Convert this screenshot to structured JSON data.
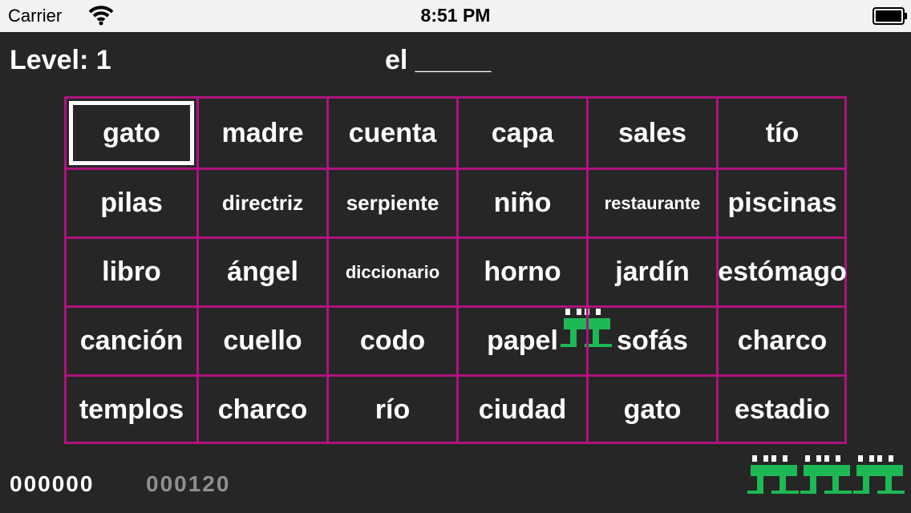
{
  "status": {
    "carrier": "Carrier",
    "time": "8:51 PM"
  },
  "hud": {
    "level": "Level: 1",
    "prompt": "el _____"
  },
  "grid": {
    "rows": [
      [
        "gato",
        "madre",
        "cuenta",
        "capa",
        "sales",
        "tío"
      ],
      [
        "pilas",
        "directriz",
        "serpiente",
        "niño",
        "restaurante",
        "piscinas"
      ],
      [
        "libro",
        "ángel",
        "diccionario",
        "horno",
        "jardín",
        "estómago"
      ],
      [
        "canción",
        "cuello",
        "codo",
        "papel",
        "sofás",
        "charco"
      ],
      [
        "templos",
        "charco",
        "río",
        "ciudad",
        "gato",
        "estadio"
      ]
    ],
    "selected": {
      "row": 0,
      "col": 0
    }
  },
  "score": "000000",
  "hiscore": "000120",
  "lives": 3,
  "colors": {
    "grid_line": "#b0127f",
    "frog": "#1db954",
    "background": "#262626",
    "hiscore": "#8f8f8f"
  },
  "icons": {
    "frog": "frog-icon",
    "wifi": "wifi-icon",
    "battery": "battery-icon"
  }
}
